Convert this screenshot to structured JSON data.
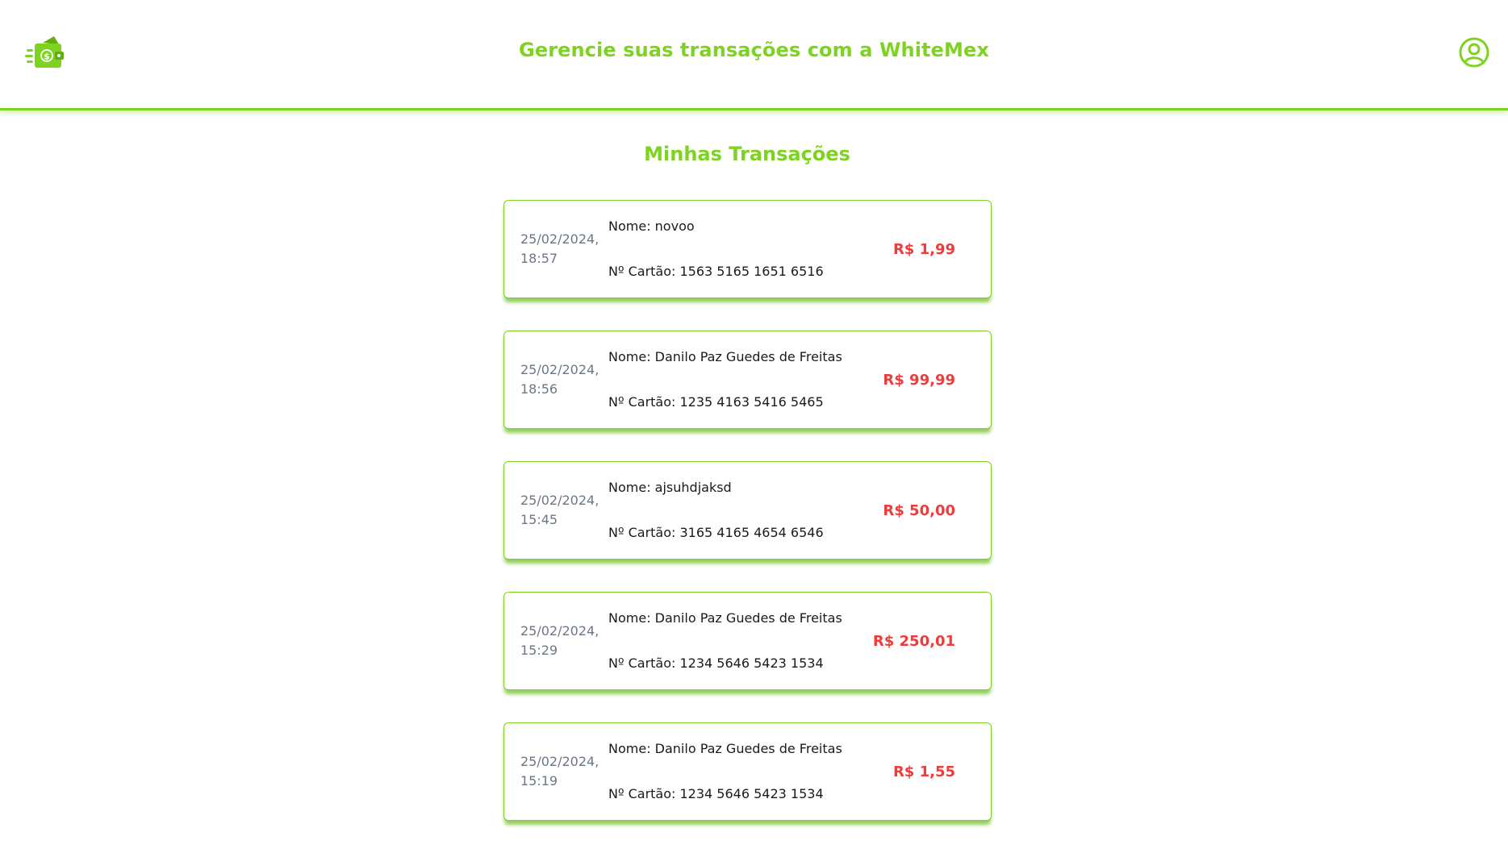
{
  "header": {
    "title": "Gerencie suas transações com a WhiteMex",
    "logo_icon": "wallet-money-icon",
    "profile_icon": "user-circle-icon"
  },
  "colors": {
    "accent": "#7ed321",
    "amount": "#ef3b3b",
    "date": "#6b7687"
  },
  "main": {
    "title": "Minhas Transações",
    "transactions": [
      {
        "date": "25/02/2024,",
        "time": "18:57",
        "name": "Nome: novoo",
        "card": "Nº Cartão: 1563 5165 1651 6516",
        "amount": "R$ 1,99"
      },
      {
        "date": "25/02/2024,",
        "time": "18:56",
        "name": "Nome: Danilo Paz Guedes de Freitas",
        "card": "Nº Cartão: 1235 4163 5416 5465",
        "amount": "R$ 99,99"
      },
      {
        "date": "25/02/2024,",
        "time": "15:45",
        "name": "Nome: ajsuhdjaksd",
        "card": "Nº Cartão: 3165 4165 4654 6546",
        "amount": "R$ 50,00"
      },
      {
        "date": "25/02/2024,",
        "time": "15:29",
        "name": "Nome: Danilo Paz Guedes de Freitas",
        "card": "Nº Cartão: 1234 5646 5423 1534",
        "amount": "R$ 250,01"
      },
      {
        "date": "25/02/2024,",
        "time": "15:19",
        "name": "Nome: Danilo Paz Guedes de Freitas",
        "card": "Nº Cartão: 1234 5646 5423 1534",
        "amount": "R$ 1,55"
      }
    ]
  }
}
